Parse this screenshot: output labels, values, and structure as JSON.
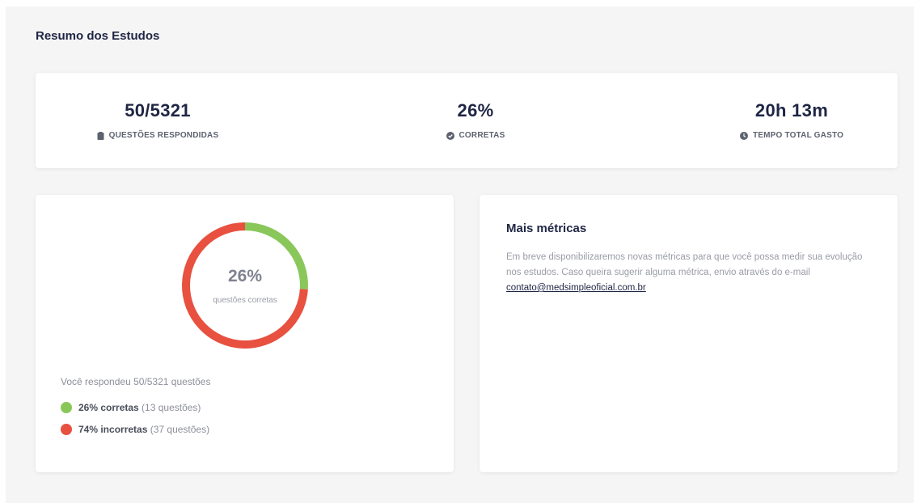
{
  "page": {
    "title": "Resumo dos Estudos"
  },
  "stats": [
    {
      "value": "50/5321",
      "label": "QUESTÕES RESPONDIDAS",
      "icon": "clipboard-icon"
    },
    {
      "value": "26%",
      "label": "CORRETAS",
      "icon": "check-circle-icon"
    },
    {
      "value": "20h 13m",
      "label": "TEMPO TOTAL GASTO",
      "icon": "clock-icon"
    }
  ],
  "chart": {
    "center_value": "26%",
    "center_caption": "questões corretas",
    "summary": "Você respondeu 50/5321 questões",
    "legend": [
      {
        "bold": "26% corretas",
        "detail": " (13 questões)"
      },
      {
        "bold": "74% incorretas",
        "detail": " (37 questões)"
      }
    ]
  },
  "chart_data": {
    "type": "pie",
    "categories": [
      "corretas",
      "incorretas"
    ],
    "values": [
      26,
      74
    ],
    "colors": [
      "#8ac75a",
      "#e8503f"
    ]
  },
  "metrics": {
    "title": "Mais métricas",
    "text": "Em breve disponibilizaremos novas métricas para que você possa medir sua evolução nos estudos. Caso queira sugerir alguma métrica, envio através do e-mail ",
    "email": "contato@medsimpleoficial.com.br"
  }
}
